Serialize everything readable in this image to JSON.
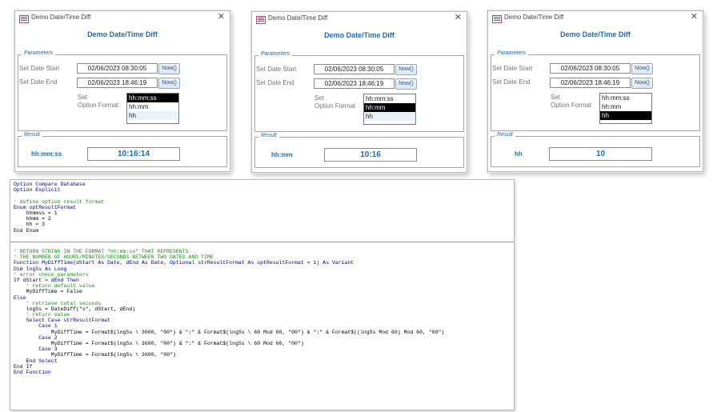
{
  "dialogs": [
    {
      "window_title": "Demo Date/Time Diff",
      "form_title": "Demo Date/Time Diff",
      "parameters_legend": "Parameters",
      "start_label": "Set Date Start",
      "start_value": "02/06/2023 08:30:05",
      "end_label": "Set Date End",
      "end_value": "02/06/2023 18:46:19",
      "now_label": "Now()",
      "option_label_1": "Set",
      "option_label_2": "Option Format",
      "options": [
        "hh:mm:ss",
        "hh:mm",
        "hh"
      ],
      "selected_option": 0,
      "result_legend": "Result",
      "result_label": "hh:mm:ss",
      "result_value": "10:16:14"
    },
    {
      "window_title": "Demo Date/Time Diff",
      "form_title": "Demo Date/Time Diff",
      "parameters_legend": "Parameters",
      "start_label": "Set Date Start",
      "start_value": "02/06/2023 08:30:05",
      "end_label": "Set Date End",
      "end_value": "02/06/2023 18:46:19",
      "now_label": "Now()",
      "option_label_1": "Set",
      "option_label_2": "Option Format",
      "options": [
        "hh:mm:ss",
        "hh:mm",
        "hh"
      ],
      "selected_option": 1,
      "result_legend": "Result",
      "result_label": "hh:mm",
      "result_value": "10:16"
    },
    {
      "window_title": "Demo Date/Time Diff",
      "form_title": "Demo Date/Time Diff",
      "parameters_legend": "Parameters",
      "start_label": "Set Date Start",
      "start_value": "02/06/2023 08:30:05",
      "end_label": "Set Date End",
      "end_value": "02/06/2023 18:46:19",
      "now_label": "Now()",
      "option_label_1": "Set",
      "option_label_2": "Option Format",
      "options": [
        "hh:mm:ss",
        "hh:mm",
        "hh"
      ],
      "selected_option": 2,
      "result_legend": "Result",
      "result_label": "hh",
      "result_value": "10"
    }
  ],
  "code": {
    "section1": [
      {
        "text": "Option Compare Database",
        "style": "kw"
      },
      {
        "text": "Option Explicit",
        "style": "kw"
      },
      {
        "text": "",
        "style": ""
      },
      {
        "text": "' define option result format",
        "style": "cm"
      },
      {
        "text": "Enum optResultFormat",
        "style": "kw"
      },
      {
        "text": "    hhmmss = 1",
        "style": ""
      },
      {
        "text": "    hhmm = 2",
        "style": ""
      },
      {
        "text": "    hh = 3",
        "style": ""
      },
      {
        "text": "End Enum",
        "style": "kw"
      }
    ],
    "section2": [
      {
        "text": "' RETURN STRING IN THE FORMAT \"hh:mm:ss\" THAT REPRESENTS",
        "style": "cm"
      },
      {
        "text": "' THE NUMBER OF HOURS/MINUTES/SECONDS BETWEEN TWO DATES AND TIME",
        "style": "cm"
      },
      {
        "text": "Function MyDiffTime(dStart As Date, dEnd As Date, Optional strResultFormat As optResultFormat = 1) As Variant",
        "style": "kw"
      },
      {
        "text": "Dim lngSs As Long",
        "style": "kw"
      },
      {
        "text": "' error check parameters",
        "style": "cm"
      },
      {
        "text": "If dStart > dEnd Then",
        "style": "kw"
      },
      {
        "text": "    ' return default value",
        "style": "cm"
      },
      {
        "text": "    MyDiffTime = False",
        "style": ""
      },
      {
        "text": "Else",
        "style": "kw"
      },
      {
        "text": "    ' retrieve total seconds",
        "style": "cm"
      },
      {
        "text": "    lngSs = DateDiff(\"s\", dStart, dEnd)",
        "style": ""
      },
      {
        "text": "    ' return value",
        "style": "cm"
      },
      {
        "text": "    Select Case strResultFormat",
        "style": "kw"
      },
      {
        "text": "        Case 1",
        "style": "kw"
      },
      {
        "text": "            MyDiffTime = Format$(lngSs \\ 3600, \"00\") & \":\" & Format$(lngSs \\ 60 Mod 60, \"00\") & \":\" & Format$((lngSs Mod 60) Mod 60, \"00\")",
        "style": ""
      },
      {
        "text": "        Case 2",
        "style": "kw"
      },
      {
        "text": "            MyDiffTime = Format$(lngSs \\ 3600, \"00\") & \":\" & Format$(lngSs \\ 60 Mod 60, \"00\")",
        "style": ""
      },
      {
        "text": "        Case 3",
        "style": "kw"
      },
      {
        "text": "            MyDiffTime = Format$(lngSs \\ 3600, \"00\")",
        "style": ""
      },
      {
        "text": "    End Select",
        "style": "kw"
      },
      {
        "text": "End If",
        "style": "kw"
      },
      {
        "text": "End Function",
        "style": "kw"
      }
    ]
  }
}
